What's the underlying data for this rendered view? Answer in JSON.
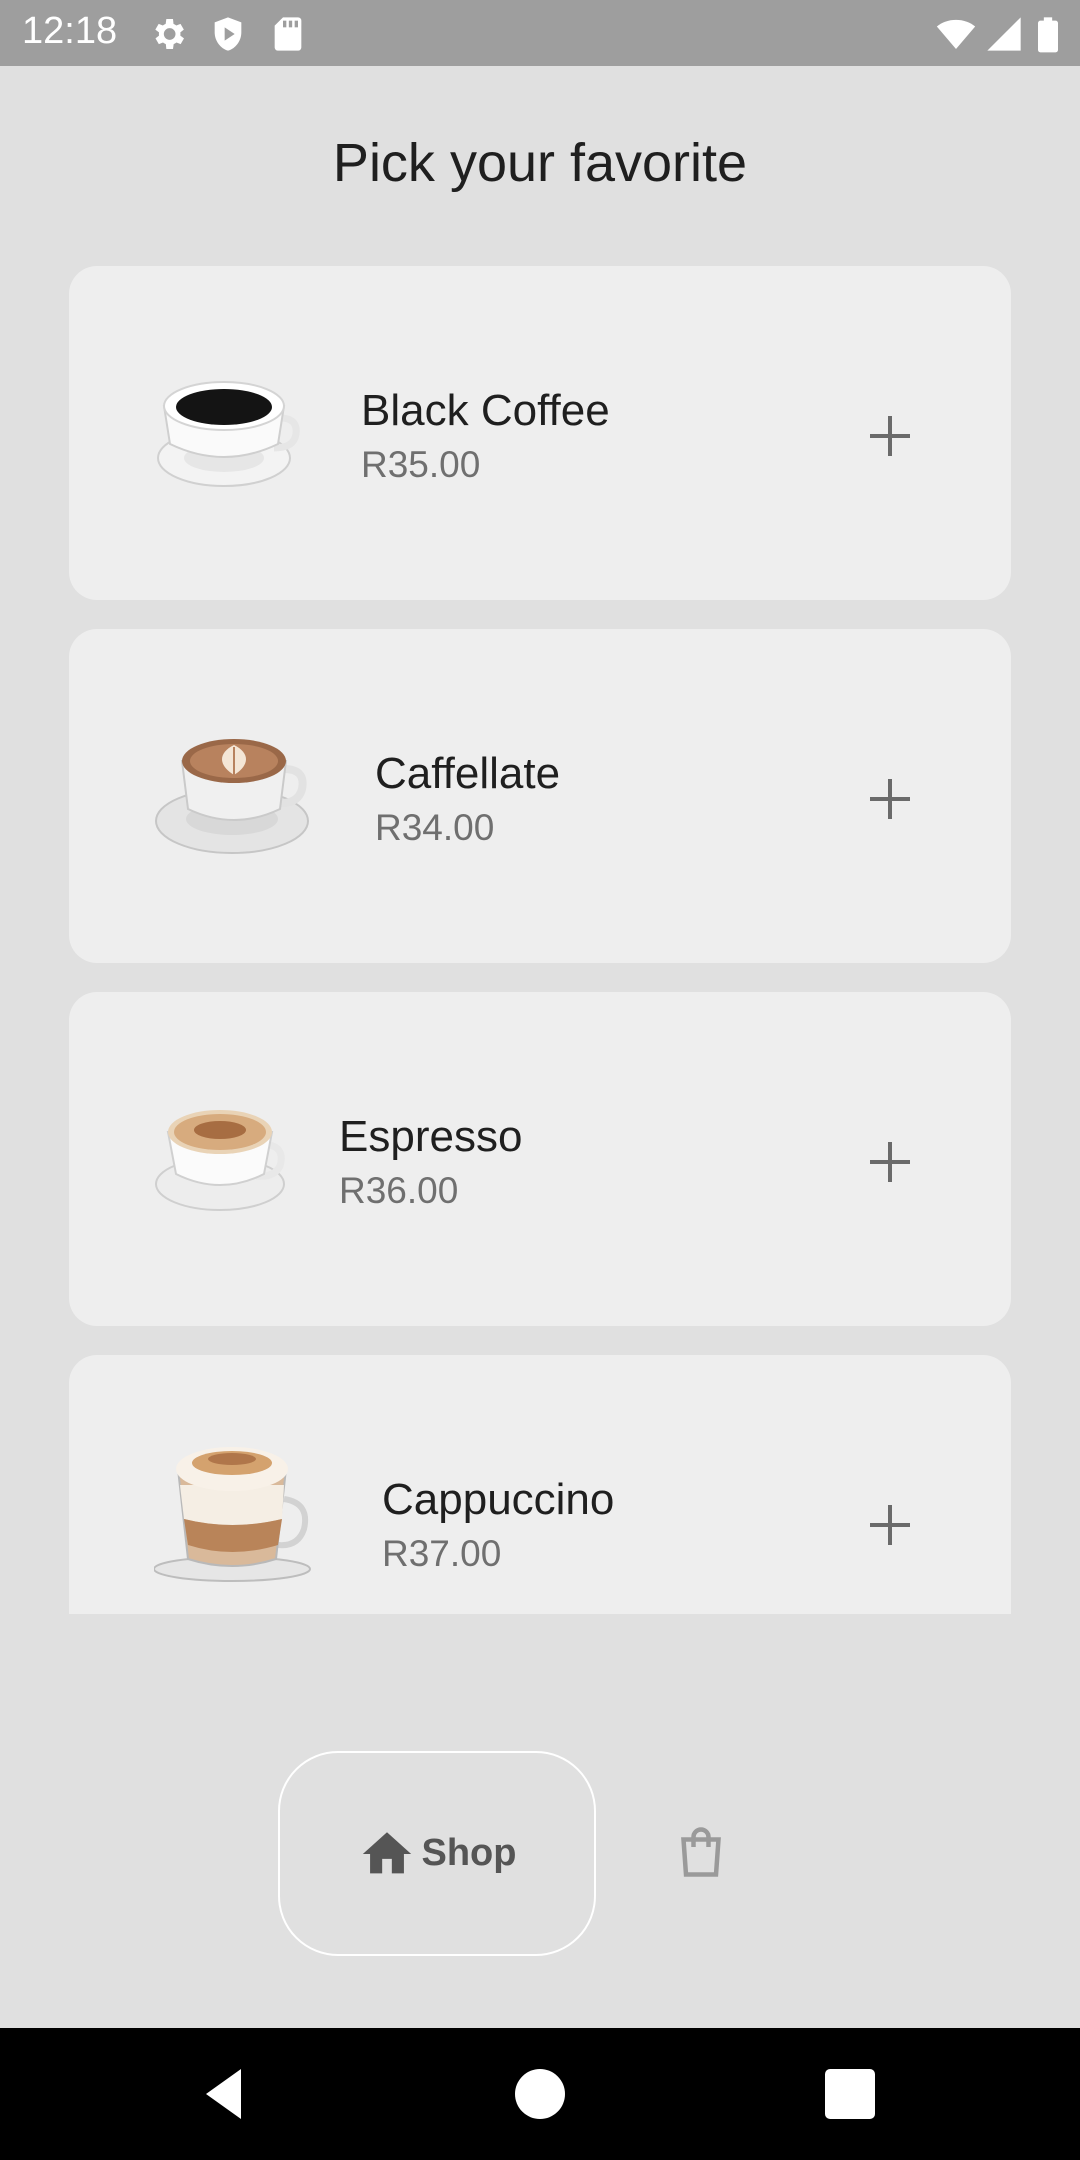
{
  "status_bar": {
    "time": "12:18",
    "icons": [
      "gear-icon",
      "shield-icon",
      "sd-card-icon",
      "wifi-icon",
      "signal-icon",
      "battery-icon"
    ]
  },
  "page": {
    "title": "Pick your favorite"
  },
  "products": [
    {
      "name": "Black Coffee",
      "price": "R35.00",
      "image": "black-coffee-cup"
    },
    {
      "name": "Caffellate",
      "price": "R34.00",
      "image": "latte-art-cup"
    },
    {
      "name": "Espresso",
      "price": "R36.00",
      "image": "espresso-cup"
    },
    {
      "name": "Cappuccino",
      "price": "R37.00",
      "image": "cappuccino-glass"
    }
  ],
  "bottom_nav": {
    "shop_label": "Shop",
    "active": "Shop",
    "icons": [
      "home-icon",
      "shopping-bag-icon"
    ]
  },
  "system_nav": {
    "icons": [
      "back-icon",
      "home-circle-icon",
      "recents-icon"
    ]
  },
  "colors": {
    "background": "#e0e0e0",
    "card": "#eeeeee",
    "status_bar": "#9e9e9e",
    "text_primary": "#1f1f1f",
    "text_secondary": "#6f6f6f"
  }
}
